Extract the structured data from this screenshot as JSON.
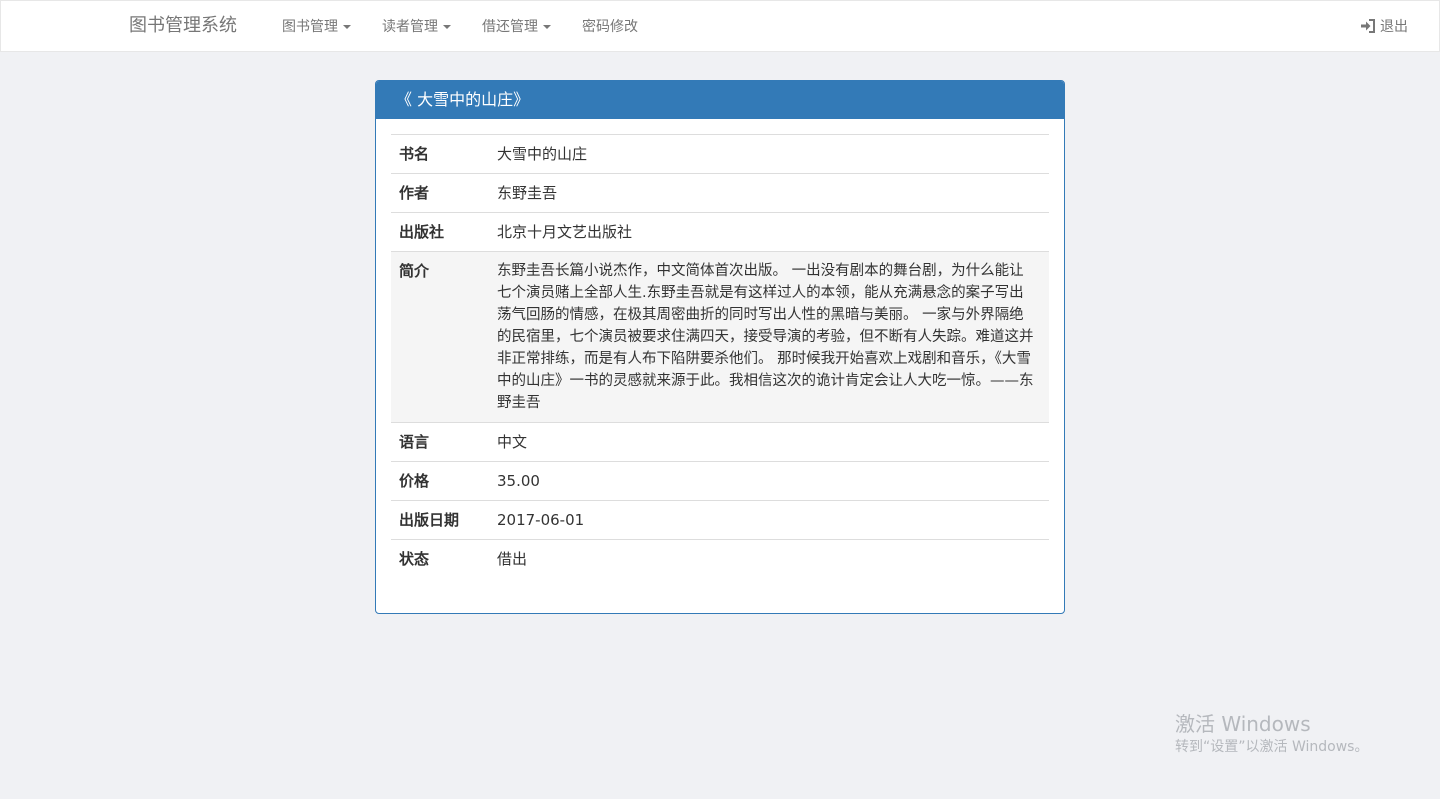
{
  "navbar": {
    "brand": "图书管理系统",
    "items": [
      {
        "label": "图书管理",
        "dropdown": true
      },
      {
        "label": "读者管理",
        "dropdown": true
      },
      {
        "label": "借还管理",
        "dropdown": true
      },
      {
        "label": "密码修改",
        "dropdown": false
      }
    ],
    "logout_label": "退出",
    "logout_icon": "log-in-icon"
  },
  "book": {
    "panel_title": "《 大雪中的山庄》",
    "rows": [
      {
        "label": "书名",
        "value": "大雪中的山庄"
      },
      {
        "label": "作者",
        "value": "东野圭吾"
      },
      {
        "label": "出版社",
        "value": "北京十月文艺出版社"
      },
      {
        "label": "简介",
        "value": "东野圭吾长篇小说杰作，中文简体首次出版。 一出没有剧本的舞台剧，为什么能让七个演员赌上全部人生.东野圭吾就是有这样过人的本领，能从充满悬念的案子写出荡气回肠的情感，在极其周密曲折的同时写出人性的黑暗与美丽。 一家与外界隔绝的民宿里，七个演员被要求住满四天，接受导演的考验，但不断有人失踪。难道这并非正常排练，而是有人布下陷阱要杀他们。 那时候我开始喜欢上戏剧和音乐，《大雪中的山庄》一书的灵感就来源于此。我相信这次的诡计肯定会让人大吃一惊。——东野圭吾"
      },
      {
        "label": "语言",
        "value": "中文"
      },
      {
        "label": "价格",
        "value": "35.00"
      },
      {
        "label": "出版日期",
        "value": "2017-06-01"
      },
      {
        "label": "状态",
        "value": "借出"
      }
    ]
  },
  "watermark": {
    "line1": "激活 Windows",
    "line2": "转到“设置”以激活 Windows。"
  },
  "colors": {
    "panel_primary": "#337ab7",
    "page_background": "#f0f1f4"
  }
}
